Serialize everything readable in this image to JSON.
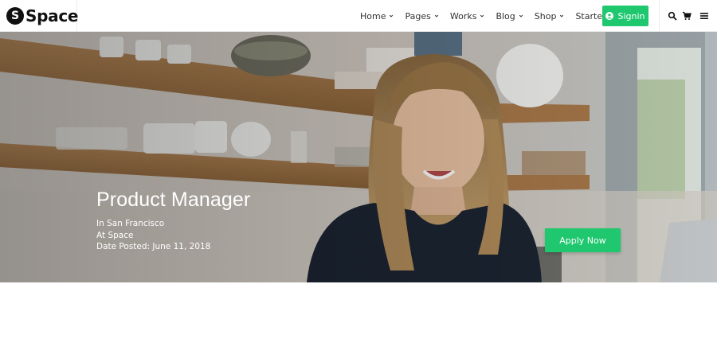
{
  "brand": {
    "badge": "S",
    "name": "Space"
  },
  "nav": {
    "items": [
      {
        "label": "Home",
        "has_caret": true
      },
      {
        "label": "Pages",
        "has_caret": true
      },
      {
        "label": "Works",
        "has_caret": true
      },
      {
        "label": "Blog",
        "has_caret": true
      },
      {
        "label": "Shop",
        "has_caret": true
      },
      {
        "label": "Starter",
        "has_caret": false
      }
    ],
    "signin_label": "Signin",
    "icons": [
      "search-icon",
      "cart-icon",
      "menu-icon"
    ]
  },
  "hero": {
    "title": "Product Manager",
    "location": "In San Francisco",
    "company": "At Space",
    "date_posted": "Date Posted: June 11, 2018",
    "apply_label": "Apply Now"
  },
  "colors": {
    "accent": "#1fc86f",
    "text_dark": "#111111",
    "hero_text": "#ffffff"
  }
}
